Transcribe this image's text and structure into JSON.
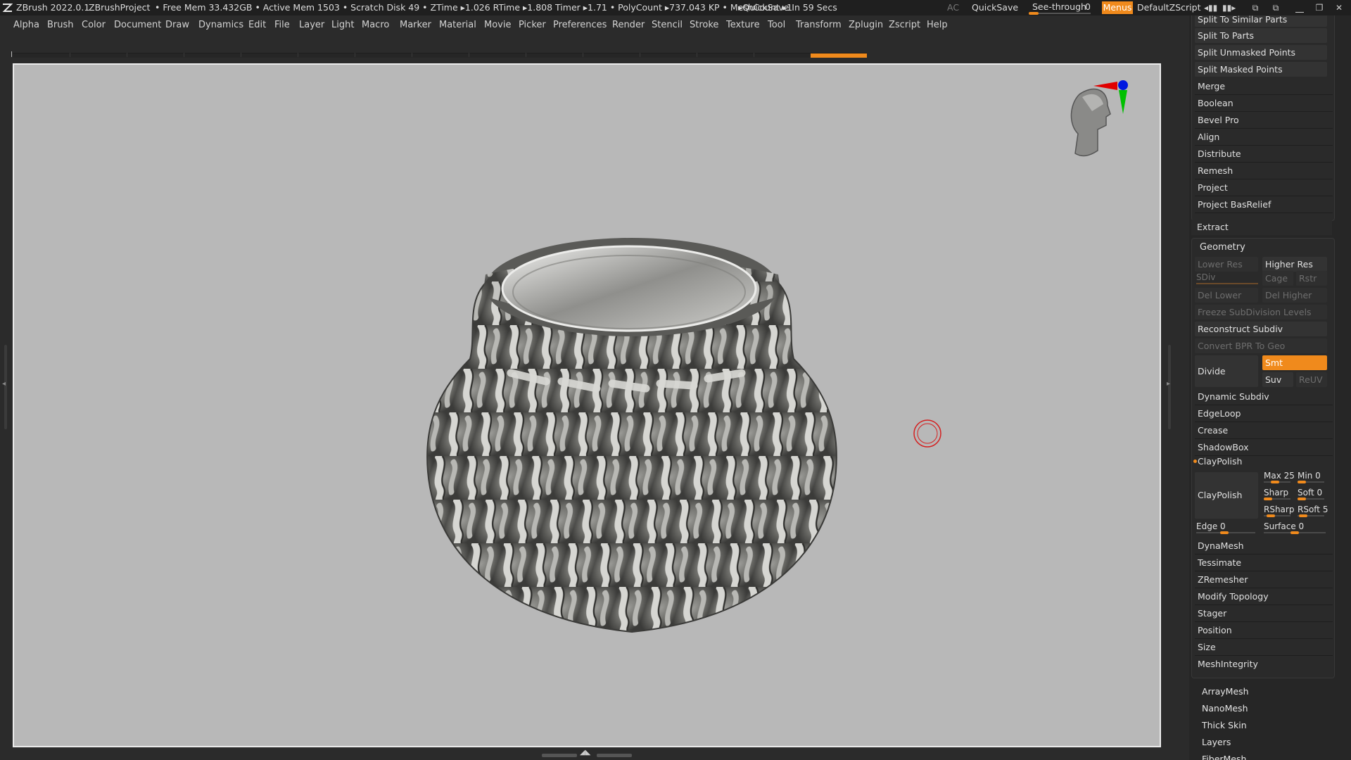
{
  "titlebar": {
    "app": "ZBrush 2022.0.1",
    "project": "ZBrushProject",
    "stats": "• Free Mem 33.432GB • Active Mem 1503 • Scratch Disk 49 •  ZTime ▸1.026 RTime ▸1.808 Timer ▸1.71 • PolyCount ▸737.043 KP  • MeshCount ▸1",
    "quicksave_timer": "▸QuickSave In 59 Secs",
    "ac": "AC",
    "quicksave": "QuickSave",
    "see_through_label": "See-through",
    "see_through_value": "0",
    "see_through_level": 0,
    "menus": "Menus",
    "default_zscript": "DefaultZScript"
  },
  "menubar": [
    "Alpha",
    "Brush",
    "Color",
    "Document",
    "Draw",
    "Dynamics",
    "Edit",
    "File",
    "Layer",
    "Light",
    "Macro",
    "Marker",
    "Material",
    "Movie",
    "Picker",
    "Preferences",
    "Render",
    "Stencil",
    "Stroke",
    "Texture",
    "Tool",
    "Transform",
    "Zplugin",
    "Zscript",
    "Help"
  ],
  "subtool_buttons": [
    "Split To Similar Parts",
    "Split To Parts",
    "Split Unmasked Points",
    "Split Masked Points",
    "Merge",
    "Boolean",
    "Bevel Pro",
    "Align",
    "Distribute",
    "Remesh",
    "Project",
    "Project BasRelief",
    "Extract"
  ],
  "geometry": {
    "title": "Geometry",
    "lower_res": "Lower Res",
    "higher_res": "Higher Res",
    "sdiv": "SDiv",
    "cage": "Cage",
    "rstr": "Rstr",
    "del_lower": "Del Lower",
    "del_higher": "Del Higher",
    "freeze": "Freeze SubDivision Levels",
    "reconstruct": "Reconstruct Subdiv",
    "convert_bpr": "Convert BPR To Geo",
    "divide": "Divide",
    "smt": "Smt",
    "suv": "Suv",
    "reuv": "ReUV",
    "items_a": [
      "Dynamic Subdiv",
      "EdgeLoop",
      "Crease",
      "ShadowBox"
    ],
    "claypolish_header": "ClayPolish",
    "claypolish_button": "ClayPolish",
    "max": "Max 25",
    "min": "Min 0",
    "sharp": "Sharp",
    "soft": "Soft 0",
    "rsharp": "RSharp",
    "rsoft": "RSoft 5",
    "edge": "Edge 0",
    "surface": "Surface 0",
    "items_b": [
      "DynaMesh",
      "Tessimate",
      "ZRemesher",
      "Modify Topology",
      "Stager",
      "Position",
      "Size",
      "MeshIntegrity"
    ]
  },
  "tool_sections": [
    "ArrayMesh",
    "NanoMesh",
    "Thick Skin",
    "Layers",
    "FiberMesh"
  ],
  "colors": {
    "accent": "#f08a1c",
    "viewport_bg": "#b8b8b8",
    "panel_bg": "#262626",
    "axis_x": "#e00000",
    "axis_y": "#00c000",
    "axis_z": "#0018e0"
  },
  "icons": [
    "zbrush-logo-icon",
    "dock-left-icon",
    "dock-right-icon",
    "popup-icon",
    "minimize-icon",
    "restore-icon",
    "close-icon",
    "orientation-head-icon",
    "brush-cursor-icon",
    "vase-mesh"
  ]
}
